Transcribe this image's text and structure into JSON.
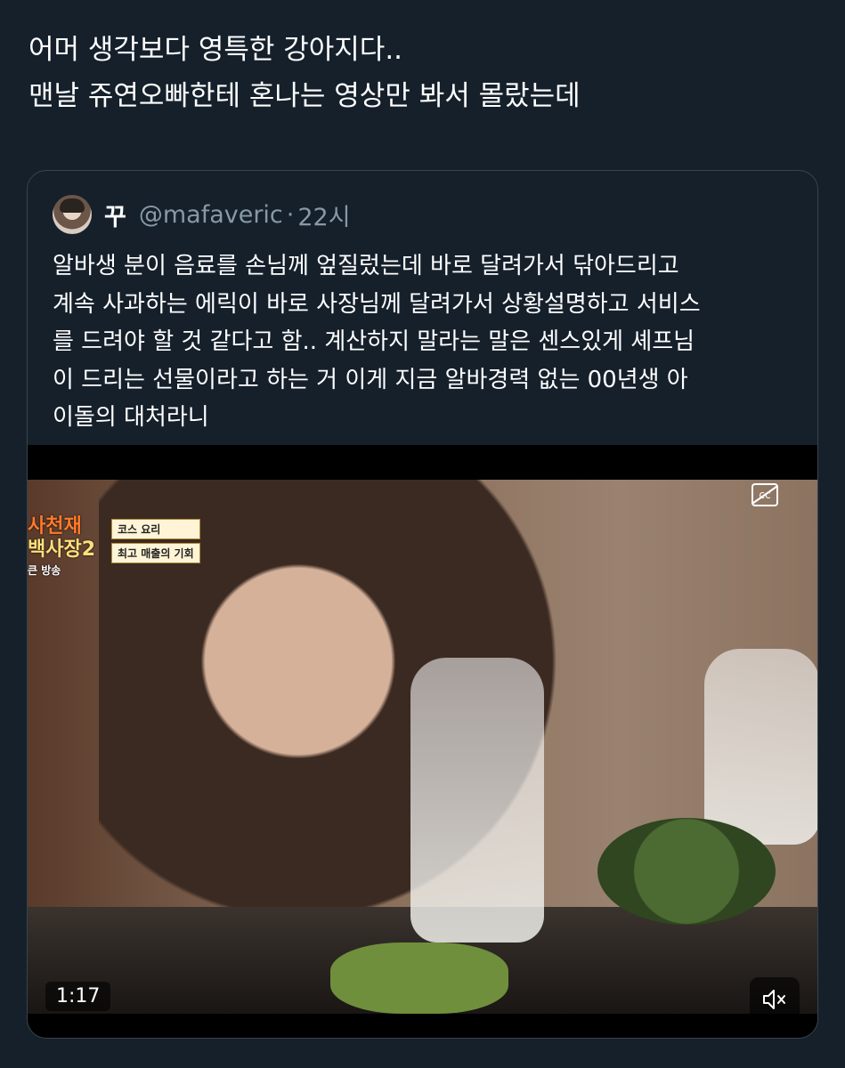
{
  "tweet": {
    "lines": [
      "어머 생각보다 영특한 강아지다..",
      "맨날 쥬연오빠한테 혼나는 영상만 봐서 몰랐는데"
    ]
  },
  "quote": {
    "display_name": "꾸",
    "handle": "@mafaveric",
    "separator": "·",
    "time": "22시",
    "lines": [
      "알바생 분이 음료를 손님께 엎질렀는데 바로 달려가서 닦아드리고",
      "계속 사과하는 에릭이 바로 사장님께 달려가서 상황설명하고 서비스",
      "를 드려야 할 것 같다고 함.. 계산하지 말라는 말은 센스있게 셰프님",
      "이 드리는 선물이라고 하는 거 이게 지금 알바경력 없는 00년생 아",
      "이돌의 대처라니"
    ],
    "video": {
      "duration": "1:17",
      "overlay_logo_line1": "사천재",
      "overlay_logo_line2": "백사장2",
      "overlay_logo_line3": "큰 방송",
      "caption_top": "코스 요리",
      "caption_bottom": "최고 매출의 기회",
      "cc_label": "cc",
      "mute_icon": "speaker-muted-icon"
    }
  },
  "colors": {
    "background": "#15202b",
    "border": "#38444d",
    "secondary_text": "#8899a6"
  }
}
